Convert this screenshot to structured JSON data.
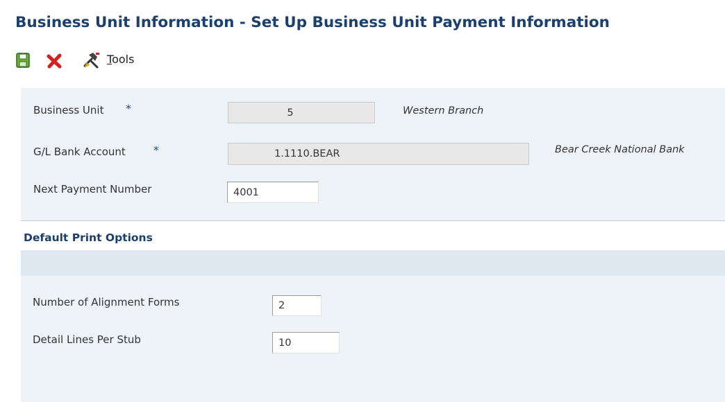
{
  "header": {
    "title": "Business Unit Information - Set Up Business Unit Payment Information"
  },
  "toolbar": {
    "save_icon": "save-icon",
    "cancel_icon": "cancel-icon",
    "tools_icon": "tools-icon",
    "tools_label_first": "T",
    "tools_label_rest": "ools"
  },
  "form": {
    "business_unit": {
      "label": "Business Unit",
      "required_mark": "*",
      "value": "5",
      "description": "Western Branch"
    },
    "gl_bank_account": {
      "label": "G/L Bank Account",
      "required_mark": "*",
      "value": "1.1110.BEAR",
      "description": "Bear Creek National Bank"
    },
    "next_payment_number": {
      "label": "Next Payment Number",
      "value": "4001"
    }
  },
  "print_options": {
    "title": "Default Print Options",
    "alignment_forms": {
      "label": "Number of Alignment Forms",
      "value": "2"
    },
    "detail_lines": {
      "label": "Detail Lines Per Stub",
      "value": "10"
    }
  },
  "colors": {
    "title": "#1b3f6e",
    "panel_background": "#eef3f8",
    "section_band": "#e0e8f1",
    "required_star": "#1b4e8a",
    "cancel_red": "#d42020"
  }
}
